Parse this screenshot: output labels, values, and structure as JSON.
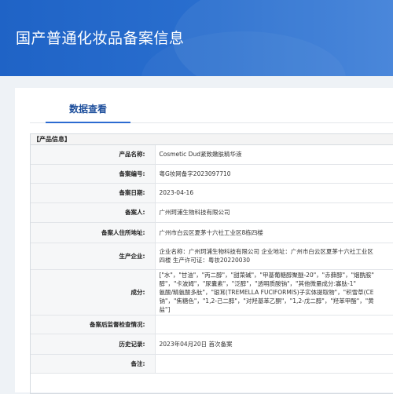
{
  "header": {
    "title": "国产普通化妆品备案信息"
  },
  "tabs": [
    {
      "label": "数据查看",
      "active": true
    }
  ],
  "section": {
    "label": "【产品信息】"
  },
  "rows": [
    {
      "label": "产品名称:",
      "value": "Cosmetic Dud紧致嫩肤精华液"
    },
    {
      "label": "备案编号:",
      "value": "粤G妆网备字2023097710"
    },
    {
      "label": "备案日期:",
      "value": "2023-04-16"
    },
    {
      "label": "备案人:",
      "value": "广州珂浦生物科技有限公司"
    },
    {
      "label": "备案人住所地址:",
      "value": "广州市白云区夏茅十六社工业区8栋四楼"
    },
    {
      "label": "生产企业:",
      "value_line1": "企业名称：广州珂浦生物科技有限公司 企业地址：广州市白云区夏茅十六社工业区",
      "value_line2": "四楼 生产许可证：粤妆20220030"
    },
    {
      "label": "成分:",
      "value_lines": [
        "[\"水\"，\"甘油\"，\"丙二醇\"，\"甜菜碱\"，\"甲基葡糖醇聚醚-20\"，\"赤藓醇\"，\"烟酰胺\"",
        "醇\"，\"卡波姆\"，\"尿囊素\"，\"泛醇\"，\"透明质酸钠\"，\"其他微量成分:寡肽-1\"",
        "氨酸/精氨酸多肽\"，\"银耳(TREMELLA FUCIFORMIS)子实体提取物\"，\"积雪草(CE",
        "钠\"，\"焦糖色\"，\"1,2-己二醇\"，\"对羟基苯乙酮\"，\"1,2-戊二醇\"，\"羟苯甲酯\"，\"黄",
        "盐\"]"
      ]
    },
    {
      "label": "备案后监督检查情况:",
      "value": ""
    },
    {
      "label": "历史记录:",
      "value": "2023年04月20日 首次备案"
    },
    {
      "label": "备注:",
      "value": ""
    }
  ]
}
